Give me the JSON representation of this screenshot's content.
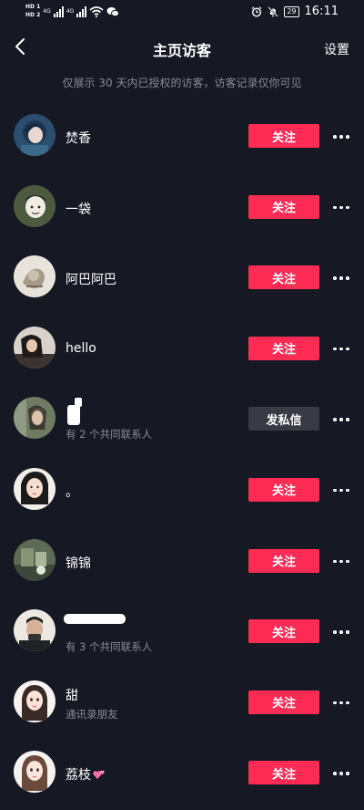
{
  "status_bar": {
    "hd_top": "HD 1",
    "hd_bottom": "HD 2",
    "net1": "4G",
    "net2": "4G",
    "battery": "29",
    "time": "16:11"
  },
  "header": {
    "title": "主页访客",
    "settings_label": "设置",
    "notice": "仅展示 30 天内已授权的访客，访客记录仅你可见"
  },
  "colors": {
    "background": "#161823",
    "follow": "#fe2c55",
    "message": "#393b44",
    "subtext": "#8a8b91"
  },
  "visitors": [
    {
      "name": "焚香",
      "sub": "",
      "action": "关注"
    },
    {
      "name": "一袋",
      "sub": "",
      "action": "关注"
    },
    {
      "name": "阿巴阿巴",
      "sub": "",
      "action": "关注"
    },
    {
      "name": "hello",
      "sub": "",
      "action": "关注"
    },
    {
      "name": "",
      "sub": "有 2 个共同联系人",
      "action": "发私信"
    },
    {
      "name": "。",
      "sub": "",
      "action": "关注"
    },
    {
      "name": "锦锦",
      "sub": "",
      "action": "关注"
    },
    {
      "name": "",
      "sub": "有 3 个共同联系人",
      "action": "关注"
    },
    {
      "name": "甜",
      "sub": "通讯录朋友",
      "action": "关注"
    },
    {
      "name": "荔枝",
      "sub": "",
      "action": "关注",
      "emoji": "two-hearts-icon"
    }
  ]
}
